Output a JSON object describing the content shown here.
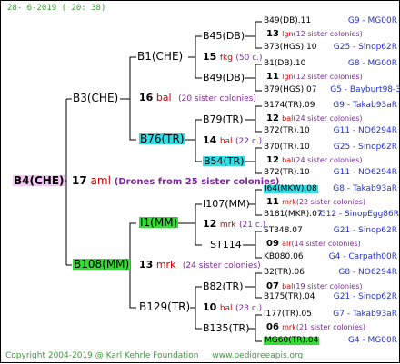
{
  "header": {
    "date": "28-  6-2019 ( 20: 38)"
  },
  "root": {
    "name": "B4(CHE)",
    "drones_num": "17",
    "drones_code": "aml",
    "drones_note": "(Drones from 25 sister colonies)"
  },
  "level1": [
    {
      "name": "B3(CHE)",
      "num": "16",
      "code": "bal",
      "note": "(20 sister colonies)"
    },
    {
      "name": "B108(MM)",
      "num": "13",
      "code": "mrk",
      "note": "(24 sister colonies)"
    }
  ],
  "level2": [
    {
      "name": "B1(CHE)",
      "num": "15",
      "code": "fkg",
      "note": "(50 c.)"
    },
    {
      "name": "B76(TR)",
      "num": "14",
      "code": "bal",
      "note": "(22 c.)"
    },
    {
      "name": "I1(MM)",
      "num": "12",
      "code": "mrk",
      "note": "(21 c.)"
    },
    {
      "name": "B129(TR)",
      "num": "10",
      "code": "bal",
      "note": "(23 c.)"
    }
  ],
  "level3": [
    {
      "name": "B45(DB)",
      "num": "13",
      "code": "lgn",
      "note": "(12 sister colonies)"
    },
    {
      "name": "B49(DB)",
      "num": "11",
      "code": "lgn",
      "note": "(12 sister colonies)"
    },
    {
      "name": "B79(TR)",
      "num": "12",
      "code": "bal",
      "note": "(24 sister colonies)"
    },
    {
      "name": "B54(TR)",
      "num": "12",
      "code": "bal",
      "note": "(24 sister colonies)"
    },
    {
      "name": "I107(MM)",
      "num": "11",
      "code": "mrk",
      "note": "(22 sister colonies)"
    },
    {
      "name": "ST114",
      "num": "09",
      "code": "alr",
      "note": "(14 sister colonies)"
    },
    {
      "name": "B82(TR)",
      "num": "07",
      "code": "bal",
      "note": "(19 sister colonies)"
    },
    {
      "name": "B135(TR)",
      "num": "06",
      "code": "mrk",
      "note": "(21 sister colonies)"
    }
  ],
  "level4": [
    {
      "name": "B49(DB).11",
      "code": "G9 - MG00R"
    },
    {
      "name": "B73(HGS).10",
      "code": "G25 - Sinop62R"
    },
    {
      "name": "B1(DB).10",
      "code": "G8 - MG00R"
    },
    {
      "name": "B79(HGS).07",
      "code": "G5 - Bayburt98-3"
    },
    {
      "name": "B174(TR).09",
      "code": "G9 - Takab93aR"
    },
    {
      "name": "B72(TR).10",
      "code": "G11 - NO6294R"
    },
    {
      "name": "B70(TR).10",
      "code": "G25 - Sinop62R"
    },
    {
      "name": "B72(TR).10",
      "code": "G11 - NO6294R"
    },
    {
      "name": "I64(MKW).08",
      "code": "G8 - Takab93aR"
    },
    {
      "name": "B181(MKR).07",
      "code": "G12 - SinopEgg86R"
    },
    {
      "name": "ST348.07",
      "code": "G21 - Sinop62R"
    },
    {
      "name": "KB080.06",
      "code": "G4 - Carpath00R"
    },
    {
      "name": "B2(TR).06",
      "code": "G8 - NO6294R"
    },
    {
      "name": "B175(TR).04",
      "code": "G21 - Sinop62R"
    },
    {
      "name": "I177(TR).05",
      "code": "G7 - Takab93aR"
    },
    {
      "name": "MG60(TR).04",
      "code": "G4 - MG00R"
    }
  ],
  "footer": {
    "copyright": "Copyright 2004-2019 @ Karl Kehrle Foundation",
    "url": "www.pedigreeapis.org"
  },
  "colors": {
    "line": "#000000",
    "green_text": "#3a9a3a",
    "blue_text": "#2233cc",
    "red_text": "#cc0000",
    "purple_text": "#7a2a9a",
    "root_bg": "#f4c6f4",
    "cyan_bg": "#33dde6",
    "green_bg": "#33dd33"
  }
}
